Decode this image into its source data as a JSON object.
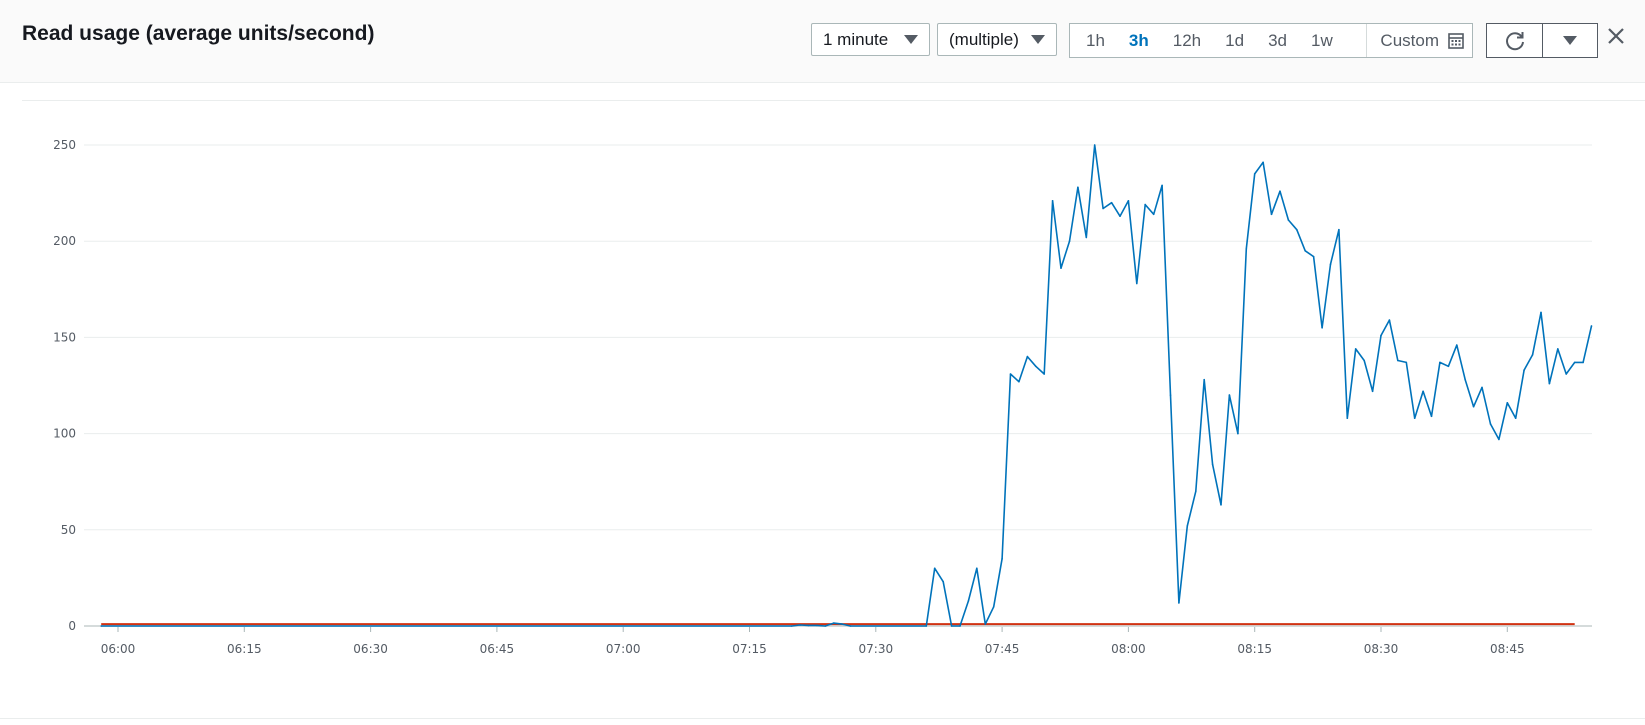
{
  "header": {
    "title": "Read usage (average units/second)",
    "period_dropdown": "1 minute",
    "stat_dropdown": "(multiple)",
    "time_ranges": [
      "1h",
      "3h",
      "12h",
      "1d",
      "3d",
      "1w"
    ],
    "active_range": "3h",
    "custom_label": "Custom",
    "icons": {
      "calendar": "calendar-icon",
      "refresh": "refresh-icon",
      "more": "chevron-down-icon",
      "close": "close-icon"
    }
  },
  "colors": {
    "series_line": "#0073bb",
    "threshold_line": "#d13212",
    "active_range": "#0073bb"
  },
  "chart_data": {
    "type": "line",
    "title": "",
    "ylim": [
      0,
      250
    ],
    "yticks": [
      0,
      50,
      100,
      150,
      200,
      250
    ],
    "xtick_labels": [
      "06:00",
      "06:15",
      "06:30",
      "06:45",
      "07:00",
      "07:15",
      "07:30",
      "07:45",
      "08:00",
      "08:15",
      "08:30",
      "08:45"
    ],
    "grid": true,
    "series": [
      {
        "color": "#0073bb",
        "points": [
          [
            "05:58",
            0
          ],
          [
            "07:20",
            0
          ],
          [
            "07:21",
            0.5
          ],
          [
            "07:22",
            0.3
          ],
          [
            "07:23",
            0.3
          ],
          [
            "07:24",
            0
          ],
          [
            "07:25",
            1.5
          ],
          [
            "07:26",
            1
          ],
          [
            "07:27",
            0
          ],
          [
            "07:36",
            0
          ],
          [
            "07:37",
            30
          ],
          [
            "07:38",
            23
          ],
          [
            "07:39",
            0
          ],
          [
            "07:40",
            0
          ],
          [
            "07:41",
            13
          ],
          [
            "07:42",
            30
          ],
          [
            "07:43",
            1
          ],
          [
            "07:44",
            10
          ],
          [
            "07:45",
            35
          ],
          [
            "07:46",
            131
          ],
          [
            "07:47",
            127
          ],
          [
            "07:48",
            140
          ],
          [
            "07:49",
            135
          ],
          [
            "07:50",
            131
          ],
          [
            "07:51",
            221
          ],
          [
            "07:52",
            186
          ],
          [
            "07:53",
            200
          ],
          [
            "07:54",
            228
          ],
          [
            "07:55",
            202
          ],
          [
            "07:56",
            250
          ],
          [
            "07:57",
            217
          ],
          [
            "07:58",
            220
          ],
          [
            "07:59",
            213
          ],
          [
            "08:00",
            221
          ],
          [
            "08:01",
            178
          ],
          [
            "08:02",
            219
          ],
          [
            "08:03",
            214
          ],
          [
            "08:04",
            229
          ],
          [
            "08:05",
            120
          ],
          [
            "08:06",
            12
          ],
          [
            "08:07",
            52
          ],
          [
            "08:08",
            70
          ],
          [
            "08:09",
            128
          ],
          [
            "08:10",
            84
          ],
          [
            "08:11",
            63
          ],
          [
            "08:12",
            120
          ],
          [
            "08:13",
            100
          ],
          [
            "08:14",
            196
          ],
          [
            "08:15",
            235
          ],
          [
            "08:16",
            241
          ],
          [
            "08:17",
            214
          ],
          [
            "08:18",
            226
          ],
          [
            "08:19",
            211
          ],
          [
            "08:20",
            206
          ],
          [
            "08:21",
            195
          ],
          [
            "08:22",
            192
          ],
          [
            "08:23",
            155
          ],
          [
            "08:24",
            188
          ],
          [
            "08:25",
            206
          ],
          [
            "08:26",
            108
          ],
          [
            "08:27",
            144
          ],
          [
            "08:28",
            138
          ],
          [
            "08:29",
            122
          ],
          [
            "08:30",
            151
          ],
          [
            "08:31",
            159
          ],
          [
            "08:32",
            138
          ],
          [
            "08:33",
            137
          ],
          [
            "08:34",
            108
          ],
          [
            "08:35",
            122
          ],
          [
            "08:36",
            109
          ],
          [
            "08:37",
            137
          ],
          [
            "08:38",
            135
          ],
          [
            "08:39",
            146
          ],
          [
            "08:40",
            128
          ],
          [
            "08:41",
            114
          ],
          [
            "08:42",
            124
          ],
          [
            "08:43",
            105
          ],
          [
            "08:44",
            97
          ],
          [
            "08:45",
            116
          ],
          [
            "08:46",
            108
          ],
          [
            "08:47",
            133
          ],
          [
            "08:48",
            141
          ],
          [
            "08:49",
            163
          ],
          [
            "08:50",
            126
          ],
          [
            "08:51",
            144
          ],
          [
            "08:52",
            131
          ],
          [
            "08:53",
            137
          ],
          [
            "08:54",
            137
          ],
          [
            "08:55",
            156
          ]
        ]
      },
      {
        "color": "#d13212",
        "points": [
          [
            "05:58",
            1
          ],
          [
            "08:53",
            1
          ]
        ]
      }
    ]
  }
}
